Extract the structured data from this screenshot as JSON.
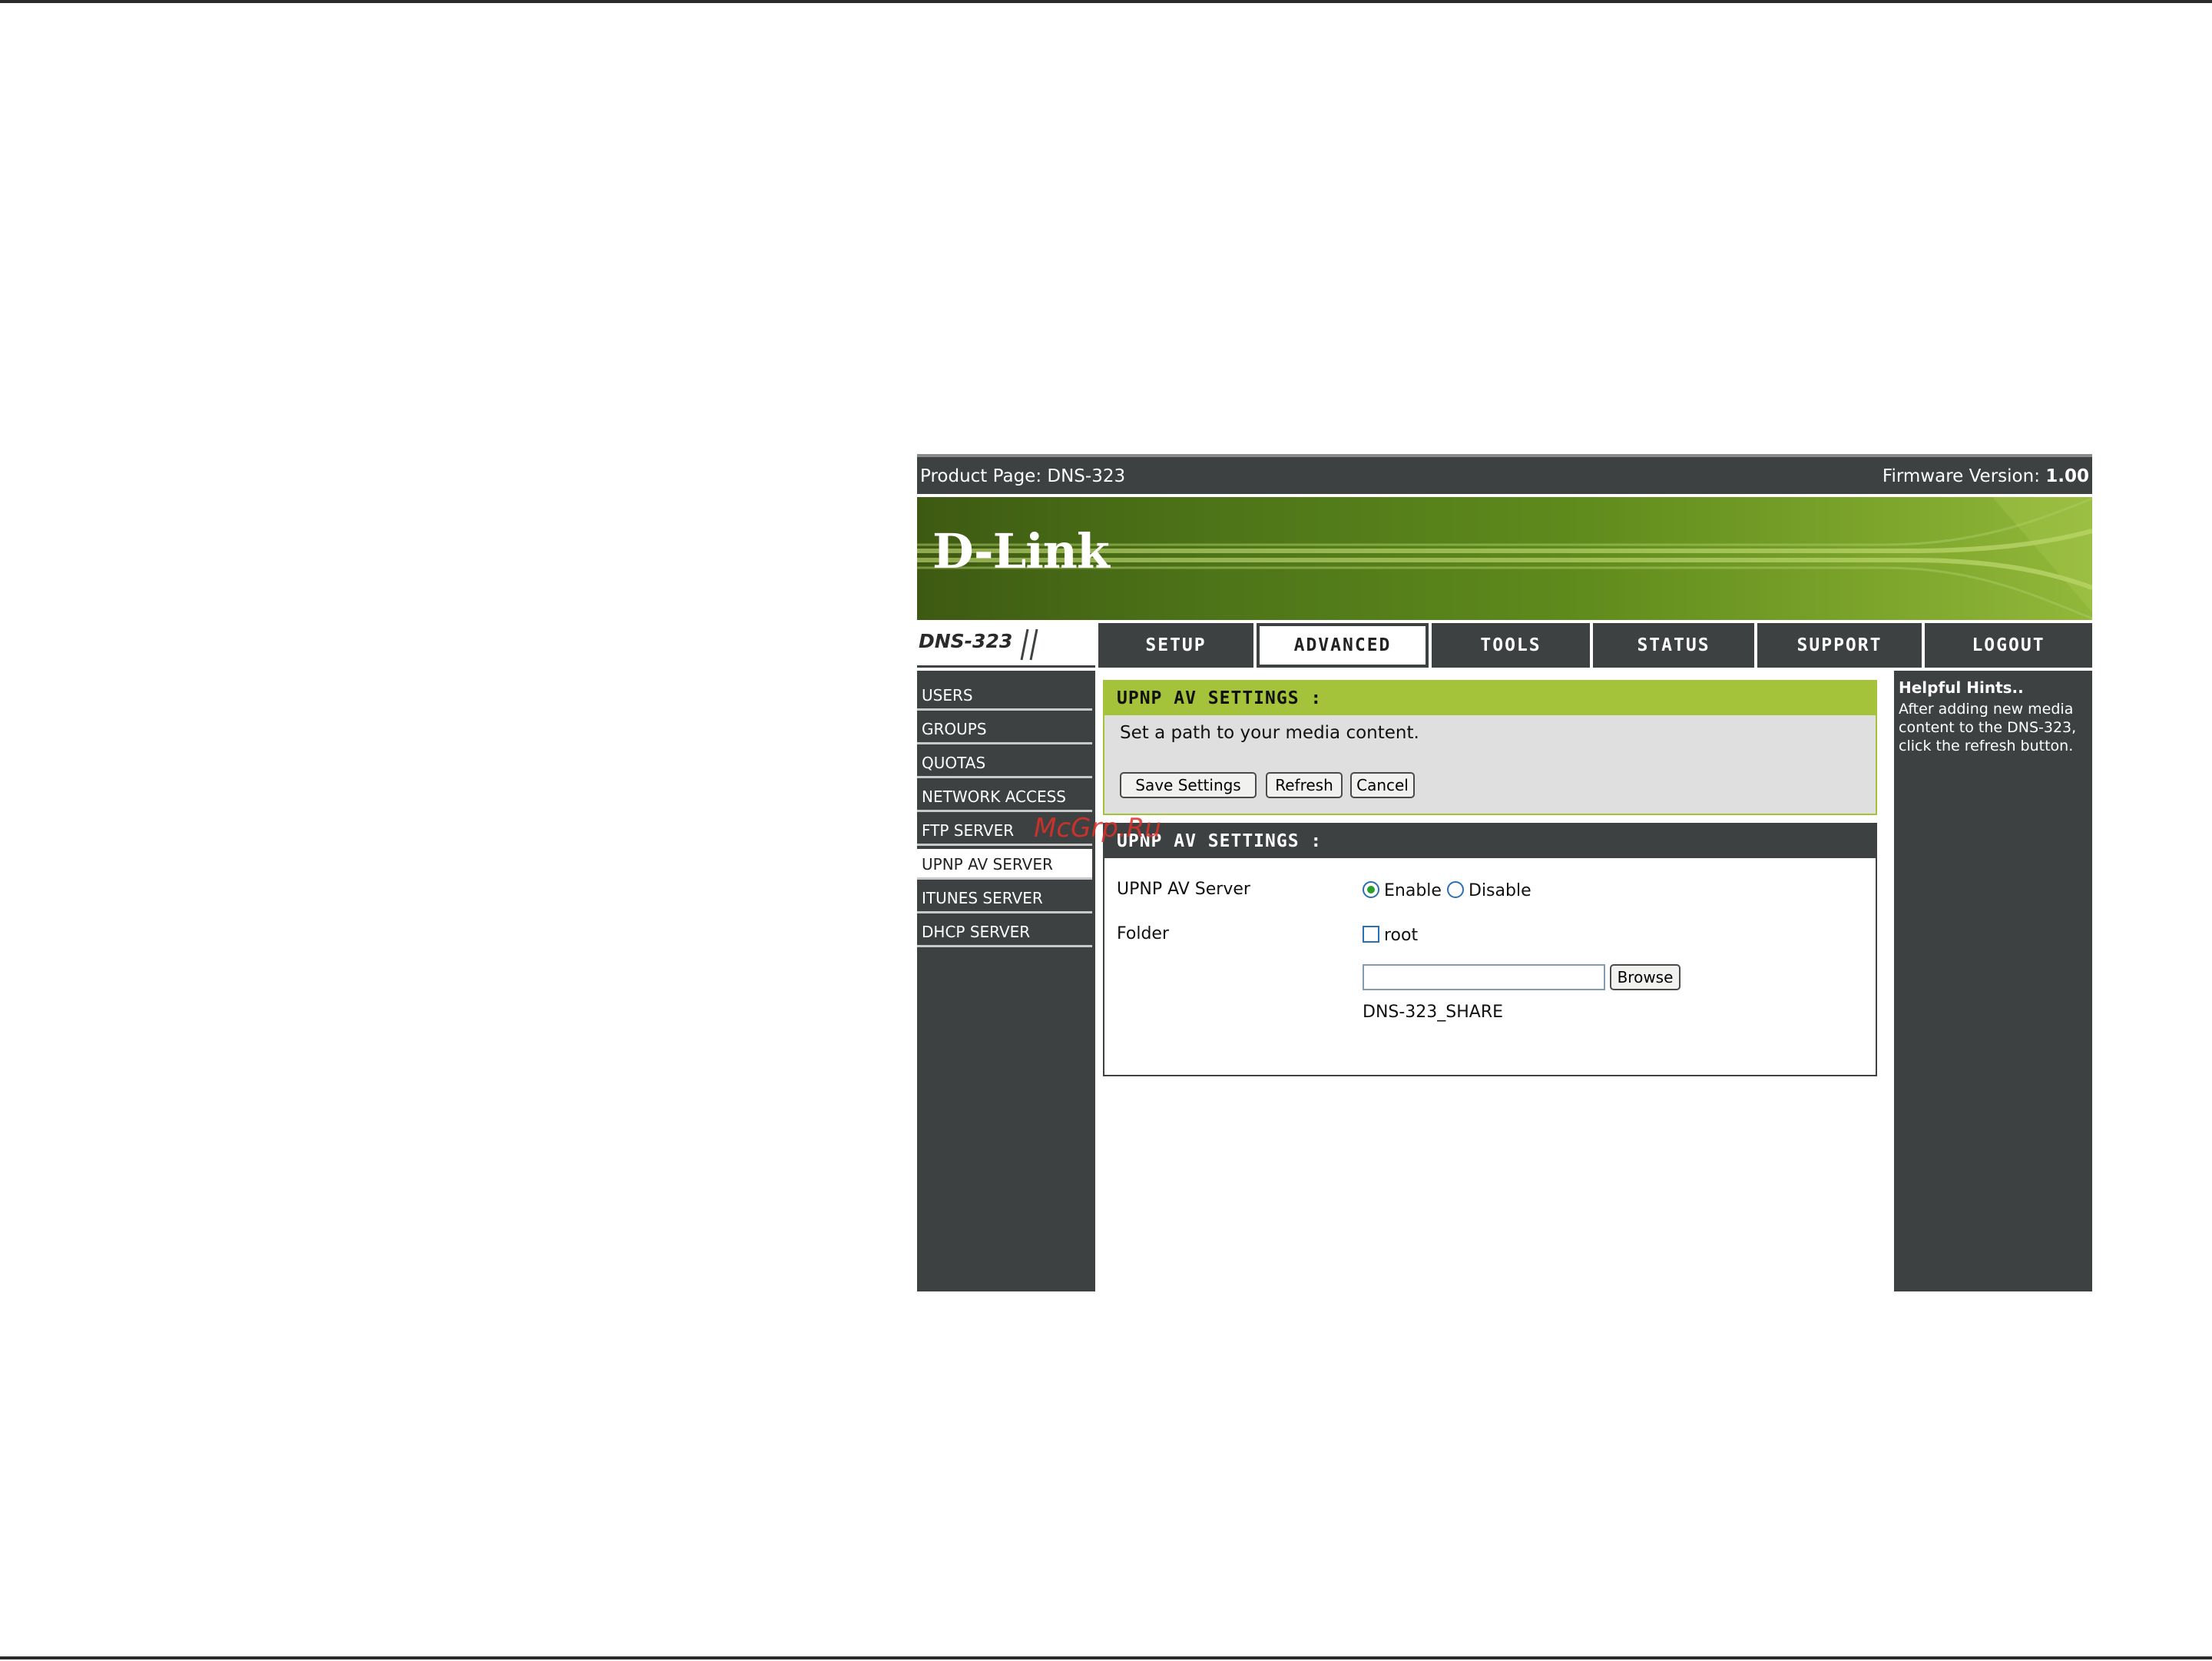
{
  "header": {
    "product_page": "Product Page: DNS-323",
    "firmware_label": "Firmware Version:",
    "firmware_value": "1.00"
  },
  "banner": {
    "logo": "D-Link"
  },
  "model": "DNS-323",
  "nav": {
    "tabs": [
      {
        "label": "SETUP",
        "active": false
      },
      {
        "label": "ADVANCED",
        "active": true
      },
      {
        "label": "TOOLS",
        "active": false
      },
      {
        "label": "STATUS",
        "active": false
      },
      {
        "label": "SUPPORT",
        "active": false
      },
      {
        "label": "LOGOUT",
        "active": false
      }
    ]
  },
  "sidebar": {
    "items": [
      {
        "label": "USERS",
        "active": false
      },
      {
        "label": "GROUPS",
        "active": false
      },
      {
        "label": "QUOTAS",
        "active": false
      },
      {
        "label": "NETWORK ACCESS",
        "active": false
      },
      {
        "label": "FTP SERVER",
        "active": false
      },
      {
        "label": "UPNP AV SERVER",
        "active": true
      },
      {
        "label": "ITUNES SERVER",
        "active": false
      },
      {
        "label": "DHCP SERVER",
        "active": false
      }
    ]
  },
  "settings_intro": {
    "title": "UPNP AV SETTINGS :",
    "description": "Set a path to your media content.",
    "buttons": {
      "save": "Save Settings",
      "refresh": "Refresh",
      "cancel": "Cancel"
    }
  },
  "settings_form": {
    "title": "UPNP AV SETTINGS :",
    "server": {
      "label": "UPNP AV Server",
      "options": [
        "Enable",
        "Disable"
      ],
      "selected": "Enable"
    },
    "folder": {
      "label": "Folder",
      "root_label": "root",
      "root_checked": false,
      "path_value": "",
      "browse_label": "Browse",
      "share_name": "DNS-323_SHARE"
    }
  },
  "hints": {
    "title": "Helpful Hints..",
    "text": "After adding new media content to the DNS-323, click the refresh button."
  },
  "watermark": "McGrp.Ru",
  "colors": {
    "panel_dark": "#3d4141",
    "accent_green": "#a5c33a",
    "banner_green": "#5e8a1c",
    "watermark_red": "#e0302a"
  }
}
